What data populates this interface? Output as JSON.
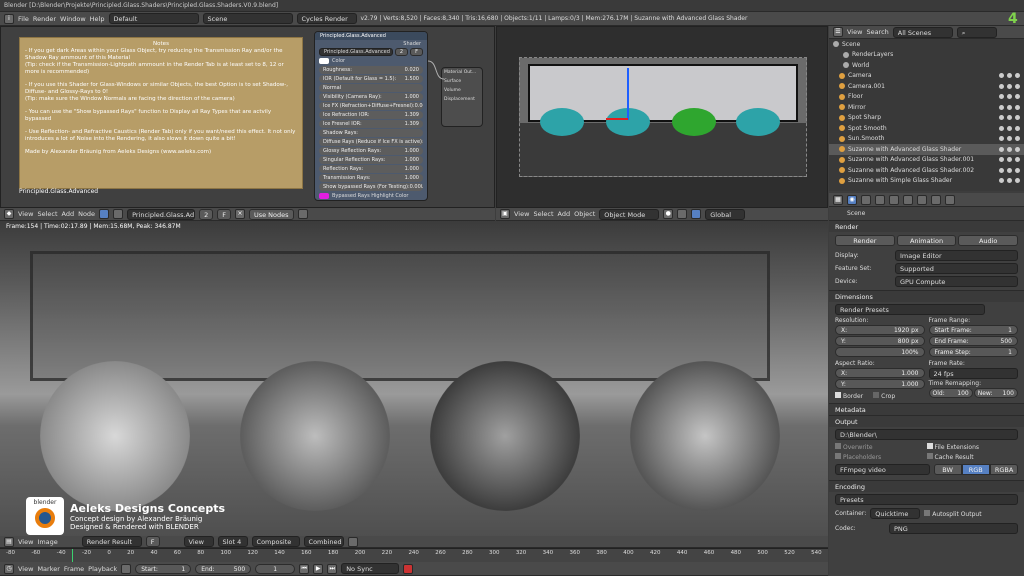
{
  "topbar": {
    "title": "Blender [D:\\Blender\\Projekte\\Principled.Glass.Shaders\\Principled.Glass.Shaders.V0.9.blend]",
    "menus": [
      "File",
      "Render",
      "Window",
      "Help"
    ],
    "layout": "Default",
    "scene": "Scene",
    "engine": "Cycles Render",
    "stats": "v2.79 | Verts:8,520 | Faces:8,340 | Tris:16,680 | Objects:1/11 | Lamps:0/3 | Mem:276.17M | Suzanne with Advanced Glass Shader"
  },
  "notes": {
    "title": "Notes",
    "lines": [
      "- If you get dark Areas within your Glass Object, try reducing the Transmission Ray and/or the Shadow Ray ammount of this Material",
      "(Tip: check if the Transmission-Lightpath ammount in the Render Tab is at least set to 8, 12 or more is recommended)",
      "",
      "- If you use this Shader for Glass-Windows or similar Objects, the best Option is to set Shadow-, Diffuse- and Glossy-Rays to 0!",
      "(Tip: make sure the Window Normals are facing the direction of the camera)",
      "",
      "- You can use the \"Show bypassed Rays\" function to Display all Ray Types that are actvily bypassed",
      "",
      "- Use Reflection- and Refractive Caustics (Render Tab) only if you want/need this effect. It not only introduces a lot of Noise into the Rendering, it also slows it down quite a bit!",
      "",
      "Made by Alexander Bräunig from Aeleks Designs (www.aeleks.com)"
    ],
    "label": "Principled.Glass.Advanced"
  },
  "node": {
    "header": "Principled.Glass.Advanced",
    "shader_out": "Shader",
    "group_name": "Principled.Glass.Advanced",
    "users": "2",
    "fake": "F",
    "color_label": "Color",
    "rows": [
      {
        "k": "Roughness:",
        "v": "0.020"
      },
      {
        "k": "IOR (Default for Glass = 1.5):",
        "v": "1.500"
      },
      {
        "k": "Normal",
        "v": ""
      },
      {
        "k": "Visibility (Camera Ray):",
        "v": "1.000"
      },
      {
        "k": "Ice FX (Refraction+Diffuse+Fresnel):",
        "v": "0.000"
      },
      {
        "k": "Ice Refraction IOR:",
        "v": "1.309"
      },
      {
        "k": "Ice Fresnel IOR:",
        "v": "1.309"
      },
      {
        "k": "Shadow Rays:",
        "v": ""
      },
      {
        "k": "Diffuse Rays (Reduce if Ice FX is active):",
        "v": "1.000"
      },
      {
        "k": "Glossy Reflection Rays:",
        "v": "1.000"
      },
      {
        "k": "Singular Reflection Rays:",
        "v": "1.000"
      },
      {
        "k": "Reflection Rays:",
        "v": "1.000"
      },
      {
        "k": "Transmission Rays:",
        "v": "1.000"
      },
      {
        "k": "Show bypassed Rays (For Testing):",
        "v": "0.000"
      }
    ],
    "highlight": "Bypassed Rays Highlight Color"
  },
  "matout": {
    "title": "Material Out...",
    "sockets": [
      "Surface",
      "Volume",
      "Displacement"
    ]
  },
  "node_toolbar": {
    "menus": [
      "View",
      "Select",
      "Add",
      "Node"
    ],
    "mat": "Principled.Glass.Ad...",
    "users": "2",
    "fake": "F",
    "use_nodes": "Use Nodes"
  },
  "view3d_toolbar": {
    "menus": [
      "View",
      "Select",
      "Add",
      "Object"
    ],
    "mode": "Object Mode",
    "orient": "Global"
  },
  "outliner": {
    "menus": [
      "View",
      "Search"
    ],
    "filter": "All Scenes",
    "items": [
      "Scene",
      "RenderLayers",
      "World",
      "Camera",
      "Camera.001",
      "Floor",
      "Mirror",
      "Spot Sharp",
      "Spot Smooth",
      "Sun.Smooth",
      "Suzanne with Advanced Glass Shader",
      "Suzanne with Advanced Glass Shader.001",
      "Suzanne with Advanced Glass Shader.002",
      "Suzanne with Simple Glass Shader"
    ]
  },
  "props": {
    "scene": "Scene",
    "render": {
      "title": "Render",
      "btn_render": "Render",
      "btn_anim": "Animation",
      "btn_audio": "Audio",
      "display_k": "Display:",
      "display_v": "Image Editor",
      "feature_k": "Feature Set:",
      "feature_v": "Supported",
      "device_k": "Device:",
      "device_v": "GPU Compute"
    },
    "dims": {
      "title": "Dimensions",
      "presets": "Render Presets",
      "res": "Resolution:",
      "x": "X:",
      "xv": "1920 px",
      "y": "Y:",
      "yv": "800 px",
      "pct": "100%",
      "fr": "Frame Range:",
      "sf": "Start Frame:",
      "sfv": "1",
      "ef": "End Frame:",
      "efv": "500",
      "fs": "Frame Step:",
      "fsv": "1",
      "aspect": "Aspect Ratio:",
      "ax": "X:",
      "axv": "1.000",
      "ay": "Y:",
      "ayv": "1.000",
      "rate": "Frame Rate:",
      "ratev": "24 fps",
      "remap": "Time Remapping:",
      "old": "Old:",
      "oldv": "100",
      "new": "New:",
      "newv": "100",
      "border": "Border",
      "crop": "Crop"
    },
    "meta": "Metadata",
    "output": {
      "title": "Output",
      "path": "D:\\Blender\\",
      "overwrite": "Overwrite",
      "ext": "File Extensions",
      "placeholders": "Placeholders",
      "cache": "Cache Result",
      "format": "FFmpeg video",
      "bw": "BW",
      "rgb": "RGB",
      "rgba": "RGBA"
    },
    "enc": {
      "title": "Encoding",
      "presets": "Presets",
      "container_k": "Container:",
      "container_v": "Quicktime",
      "autosplit": "Autosplit Output",
      "codec_k": "Codec:",
      "codec_v": "PNG"
    }
  },
  "render_info": "Frame:154 | Time:02:17.89 | Mem:15.68M, Peak: 346.87M",
  "logo": {
    "brand": "blender",
    "title": "Aeleks Designs Concepts",
    "l1": "Concept design by Alexander Bräunig",
    "l2": "Designed & Rendered with BLENDER"
  },
  "img_toolbar": {
    "menus": [
      "View",
      "Image"
    ],
    "image": "Render Result",
    "fake": "F",
    "view": "View",
    "slot": "Slot 4",
    "layer": "Composite",
    "pass": "Combined"
  },
  "timeline": {
    "ticks": [
      "-80",
      "-60",
      "-40",
      "-20",
      "0",
      "20",
      "40",
      "60",
      "80",
      "100",
      "120",
      "140",
      "160",
      "180",
      "200",
      "220",
      "240",
      "260",
      "280",
      "300",
      "320",
      "340",
      "360",
      "380",
      "400",
      "420",
      "440",
      "460",
      "480",
      "500",
      "520",
      "540"
    ],
    "menus": [
      "View",
      "Marker",
      "Frame",
      "Playback"
    ],
    "start": "Start:",
    "startv": "1",
    "end": "End:",
    "endv": "500",
    "cur": "1",
    "sync": "No Sync"
  },
  "colors": {
    "accent": "#5680c2",
    "header": "#4a4a4a",
    "notes": "#b79d67"
  }
}
